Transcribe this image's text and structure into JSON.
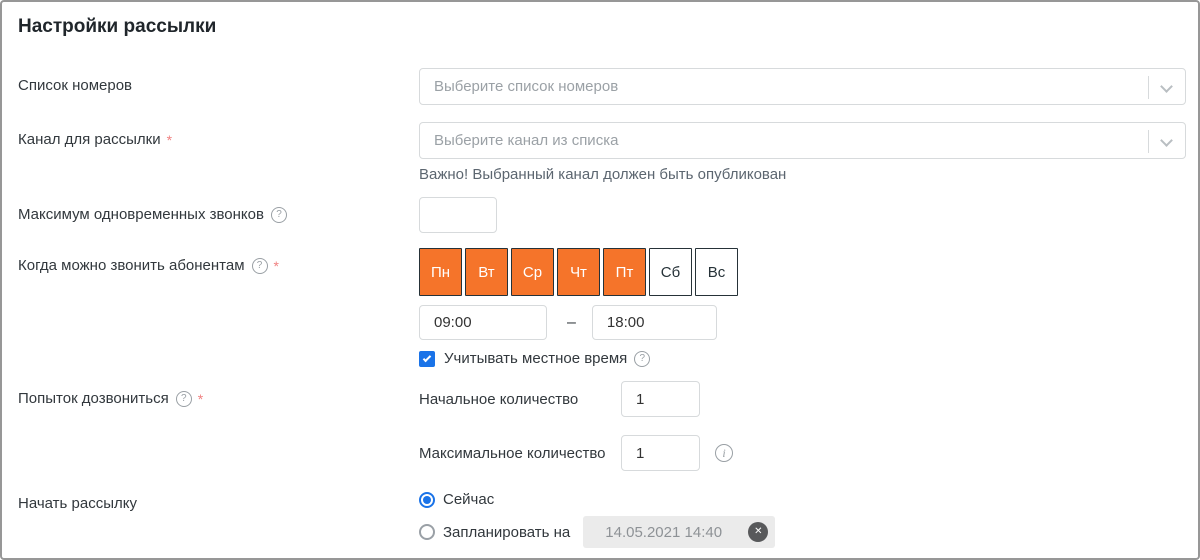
{
  "ui": {
    "required_mark": "*",
    "help_glyph": "?",
    "info_glyph": "i",
    "clear_glyph": "✕",
    "range_dash": "–"
  },
  "header": {
    "title": "Настройки рассылки"
  },
  "form": {
    "number_list": {
      "label": "Список номеров",
      "placeholder": "Выберите список номеров"
    },
    "channel": {
      "label": "Канал для рассылки",
      "placeholder": "Выберите канал из списка",
      "note": "Важно! Выбранный канал должен быть опубликован"
    },
    "max_concurrent_calls": {
      "label": "Максимум одновременных звонков",
      "value": ""
    },
    "call_window": {
      "label": "Когда можно звонить абонентам",
      "days": [
        {
          "label": "Пн",
          "active": true
        },
        {
          "label": "Вт",
          "active": true
        },
        {
          "label": "Ср",
          "active": true
        },
        {
          "label": "Чт",
          "active": true
        },
        {
          "label": "Пт",
          "active": true
        },
        {
          "label": "Сб",
          "active": false
        },
        {
          "label": "Вс",
          "active": false
        }
      ],
      "time_from": "09:00",
      "time_to": "18:00",
      "local_time": {
        "label": "Учитывать местное время",
        "checked": true
      }
    },
    "dial_attempts": {
      "label": "Попыток дозвониться",
      "initial": {
        "label": "Начальное количество",
        "value": "1"
      },
      "maximum": {
        "label": "Максимальное количество",
        "value": "1"
      }
    },
    "start": {
      "label": "Начать рассылку",
      "now": {
        "label": "Сейчас",
        "selected": true
      },
      "schedule": {
        "label": "Запланировать на",
        "selected": false,
        "value": "14.05.2021 14:40"
      }
    }
  },
  "colors": {
    "accent_orange": "#F5742A",
    "accent_blue": "#1A73E8",
    "day_button_border": "#263238",
    "input_border": "#D7DADC",
    "placeholder_text": "#9BA1A6",
    "disabled_input_bg": "#EBEBEB",
    "required_asterisk": "#F08080",
    "panel_border": "#979797"
  }
}
